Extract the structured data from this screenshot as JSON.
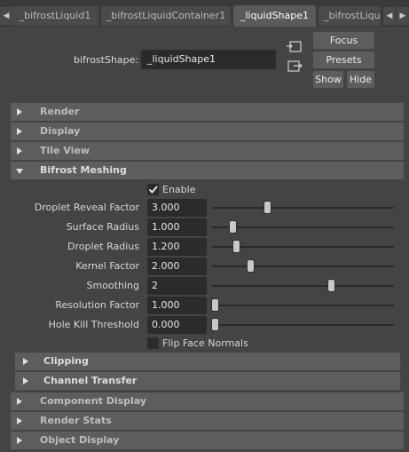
{
  "tabs": [
    {
      "label": "_bifrostLiquid1",
      "active": false
    },
    {
      "label": "_bifrostLiquidContainer1",
      "active": false
    },
    {
      "label": "_liquidShape1",
      "active": true
    },
    {
      "label": "_bifrostLiqu",
      "active": false
    }
  ],
  "header": {
    "shape_label": "bifrostShape:",
    "shape_value": "_liquidShape1",
    "icons": [
      "load-attributes-icon",
      "copy-tab-icon"
    ],
    "focus_label": "Focus",
    "presets_label": "Presets",
    "show_label": "Show",
    "hide_label": "Hide"
  },
  "sections_top": [
    {
      "title": "Render",
      "expanded": false
    },
    {
      "title": "Display",
      "expanded": false
    },
    {
      "title": "Tile View",
      "expanded": false
    },
    {
      "title": "Bifrost Meshing",
      "expanded": true
    }
  ],
  "meshing": {
    "enable_label": "Enable",
    "enable_checked": true,
    "attributes": [
      {
        "label": "Droplet Reveal Factor",
        "value": "3.000",
        "slider": 0.3
      },
      {
        "label": "Surface Radius",
        "value": "1.000",
        "slider": 0.1
      },
      {
        "label": "Droplet Radius",
        "value": "1.200",
        "slider": 0.12
      },
      {
        "label": "Kernel Factor",
        "value": "2.000",
        "slider": 0.2
      },
      {
        "label": "Smoothing",
        "value": "2",
        "slider": 0.66
      },
      {
        "label": "Resolution Factor",
        "value": "1.000",
        "slider": 0.0
      },
      {
        "label": "Hole Kill Threshold",
        "value": "0.000",
        "slider": 0.0
      }
    ],
    "flip_label": "Flip Face Normals",
    "flip_checked": false,
    "subsections": [
      {
        "title": "Clipping",
        "expanded": false
      },
      {
        "title": "Channel Transfer",
        "expanded": false
      }
    ]
  },
  "sections_bottom": [
    {
      "title": "Component Display",
      "expanded": false
    },
    {
      "title": "Render Stats",
      "expanded": false
    },
    {
      "title": "Object Display",
      "expanded": false
    }
  ]
}
